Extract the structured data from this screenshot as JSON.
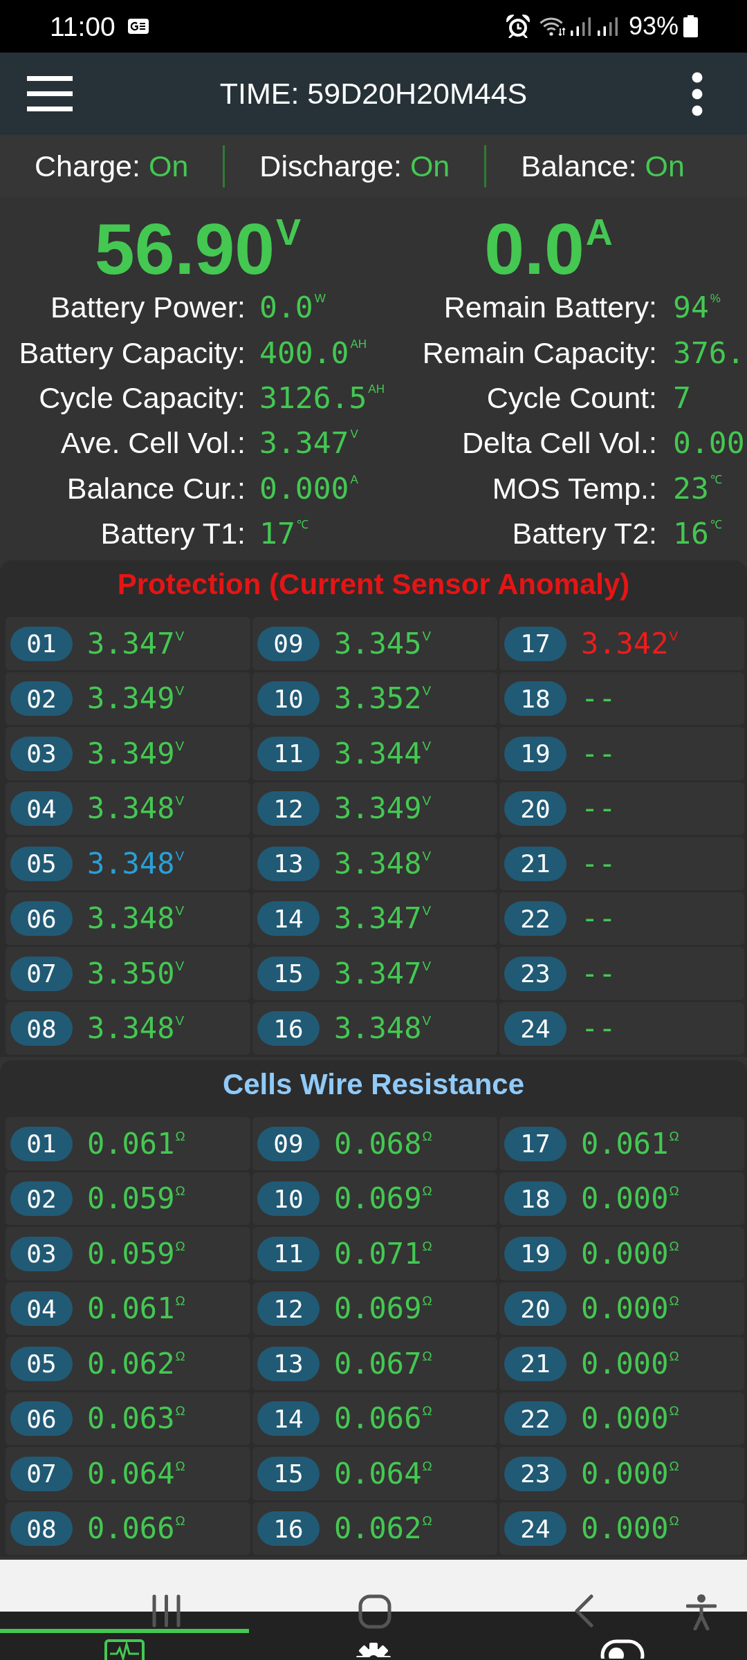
{
  "status_bar": {
    "time": "11:00",
    "battery": "93%"
  },
  "app_bar": {
    "title": "TIME: 59D20H20M44S"
  },
  "switches": [
    {
      "label": "Charge:",
      "value": "On",
      "on": true
    },
    {
      "label": "Discharge:",
      "value": "On",
      "on": true
    },
    {
      "label": "Balance:",
      "value": "On",
      "on": true
    }
  ],
  "readings": [
    {
      "value": "56.90",
      "unit": "V"
    },
    {
      "value": "0.0",
      "unit": "A"
    }
  ],
  "stats": [
    {
      "label": "Battery Power:",
      "value": "0.0",
      "unit": "W"
    },
    {
      "label": "Remain Battery:",
      "value": "94",
      "unit": "%"
    },
    {
      "label": "Battery Capacity:",
      "value": "400.0",
      "unit": "AH"
    },
    {
      "label": "Remain Capacity:",
      "value": "376."
    },
    {
      "label": "Cycle Capacity:",
      "value": "3126.5",
      "unit": "AH"
    },
    {
      "label": "Cycle Count:",
      "value": "7"
    },
    {
      "label": "Ave. Cell Vol.:",
      "value": "3.347",
      "unit": "V"
    },
    {
      "label": "Delta Cell Vol.:",
      "value": "0.00"
    },
    {
      "label": "Balance Cur.:",
      "value": "0.000",
      "unit": "A"
    },
    {
      "label": "MOS Temp.:",
      "value": "23",
      "unit": "℃"
    },
    {
      "label": "Battery T1:",
      "value": "17",
      "unit": "℃"
    },
    {
      "label": "Battery T2:",
      "value": "16",
      "unit": "℃"
    }
  ],
  "sections": [
    {
      "title": "Protection (Current Sensor Anomaly)",
      "alert": true,
      "cells": [
        {
          "number": "01",
          "value": "3.347",
          "unit": "V",
          "color": "#44c852"
        },
        {
          "number": "02",
          "value": "3.349",
          "unit": "V",
          "color": "#44c852"
        },
        {
          "number": "03",
          "value": "3.349",
          "unit": "V",
          "color": "#44c852"
        },
        {
          "number": "04",
          "value": "3.348",
          "unit": "V",
          "color": "#44c852"
        },
        {
          "number": "05",
          "value": "3.348",
          "unit": "V",
          "color": "#2a9fd6"
        },
        {
          "number": "06",
          "value": "3.348",
          "unit": "V",
          "color": "#44c852"
        },
        {
          "number": "07",
          "value": "3.350",
          "unit": "V",
          "color": "#44c852"
        },
        {
          "number": "08",
          "value": "3.348",
          "unit": "V",
          "color": "#44c852"
        },
        {
          "number": "09",
          "value": "3.345",
          "unit": "V",
          "color": "#44c852"
        },
        {
          "number": "10",
          "value": "3.352",
          "unit": "V",
          "color": "#44c852"
        },
        {
          "number": "11",
          "value": "3.344",
          "unit": "V",
          "color": "#44c852"
        },
        {
          "number": "12",
          "value": "3.349",
          "unit": "V",
          "color": "#44c852"
        },
        {
          "number": "13",
          "value": "3.348",
          "unit": "V",
          "color": "#44c852"
        },
        {
          "number": "14",
          "value": "3.347",
          "unit": "V",
          "color": "#44c852"
        },
        {
          "number": "15",
          "value": "3.347",
          "unit": "V",
          "color": "#44c852"
        },
        {
          "number": "16",
          "value": "3.348",
          "unit": "V",
          "color": "#44c852"
        },
        {
          "number": "17",
          "value": "3.342",
          "unit": "V",
          "color": "#ee1c1c"
        },
        {
          "number": "18",
          "value": "--",
          "color": "#44c852"
        },
        {
          "number": "19",
          "value": "--",
          "color": "#44c852"
        },
        {
          "number": "20",
          "value": "--",
          "color": "#44c852"
        },
        {
          "number": "21",
          "value": "--",
          "color": "#44c852"
        },
        {
          "number": "22",
          "value": "--",
          "color": "#44c852"
        },
        {
          "number": "23",
          "value": "--",
          "color": "#44c852"
        },
        {
          "number": "24",
          "value": "--",
          "color": "#44c852"
        }
      ]
    },
    {
      "title": "Cells Wire Resistance",
      "alert": false,
      "cells": [
        {
          "number": "01",
          "value": "0.061",
          "unit": "Ω"
        },
        {
          "number": "02",
          "value": "0.059",
          "unit": "Ω"
        },
        {
          "number": "03",
          "value": "0.059",
          "unit": "Ω"
        },
        {
          "number": "04",
          "value": "0.061",
          "unit": "Ω"
        },
        {
          "number": "05",
          "value": "0.062",
          "unit": "Ω"
        },
        {
          "number": "06",
          "value": "0.063",
          "unit": "Ω"
        },
        {
          "number": "07",
          "value": "0.064",
          "unit": "Ω"
        },
        {
          "number": "08",
          "value": "0.066",
          "unit": "Ω"
        },
        {
          "number": "09",
          "value": "0.068",
          "unit": "Ω"
        },
        {
          "number": "10",
          "value": "0.069",
          "unit": "Ω"
        },
        {
          "number": "11",
          "value": "0.071",
          "unit": "Ω"
        },
        {
          "number": "12",
          "value": "0.069",
          "unit": "Ω"
        },
        {
          "number": "13",
          "value": "0.067",
          "unit": "Ω"
        },
        {
          "number": "14",
          "value": "0.066",
          "unit": "Ω"
        },
        {
          "number": "15",
          "value": "0.064",
          "unit": "Ω"
        },
        {
          "number": "16",
          "value": "0.062",
          "unit": "Ω"
        },
        {
          "number": "17",
          "value": "0.061",
          "unit": "Ω"
        },
        {
          "number": "18",
          "value": "0.000",
          "unit": "Ω"
        },
        {
          "number": "19",
          "value": "0.000",
          "unit": "Ω"
        },
        {
          "number": "20",
          "value": "0.000",
          "unit": "Ω"
        },
        {
          "number": "21",
          "value": "0.000",
          "unit": "Ω"
        },
        {
          "number": "22",
          "value": "0.000",
          "unit": "Ω"
        },
        {
          "number": "23",
          "value": "0.000",
          "unit": "Ω"
        },
        {
          "number": "24",
          "value": "0.000",
          "unit": "Ω"
        }
      ]
    }
  ],
  "bottom_tabs": [
    {
      "selected": true
    },
    {
      "selected": false
    },
    {
      "selected": false
    }
  ]
}
